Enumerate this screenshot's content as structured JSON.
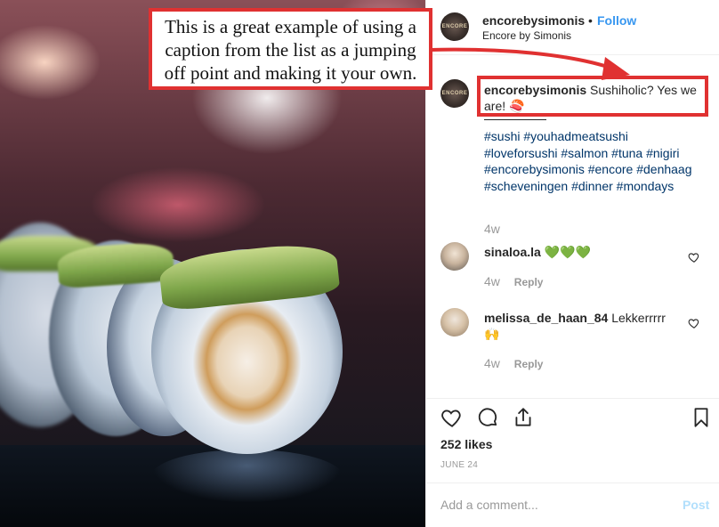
{
  "callout": {
    "text": "This is a great example of using a caption from the list as a jumping off point and making it your own."
  },
  "header": {
    "username": "encorebysimonis",
    "separator": "•",
    "follow_label": "Follow",
    "subtitle": "Encore by Simonis",
    "avatar_text": "ENCORE"
  },
  "caption": {
    "username": "encorebysimonis",
    "text": "Sushiholic? Yes we are! 🍣",
    "hashtags": "#sushi #youhadmeatsushi #loveforsushi #salmon #tuna #nigiri #encorebysimonis #encore #denhaag #scheveningen #dinner #mondays",
    "time": "4w"
  },
  "comments": [
    {
      "username": "sinaloa.la",
      "text": "💚💚💚",
      "time": "4w",
      "reply": "Reply"
    },
    {
      "username": "melissa_de_haan_84",
      "text": "Lekkerrrrr 🙌",
      "time": "4w",
      "reply": "Reply"
    }
  ],
  "actions": {
    "likes": "252 likes",
    "date": "JUNE 24"
  },
  "add_comment": {
    "placeholder": "Add a comment...",
    "post_label": "Post"
  },
  "colors": {
    "accent_red": "#e03131",
    "follow_blue": "#3897f0",
    "hashtag": "#003569",
    "post_disabled": "#b2dffc"
  }
}
